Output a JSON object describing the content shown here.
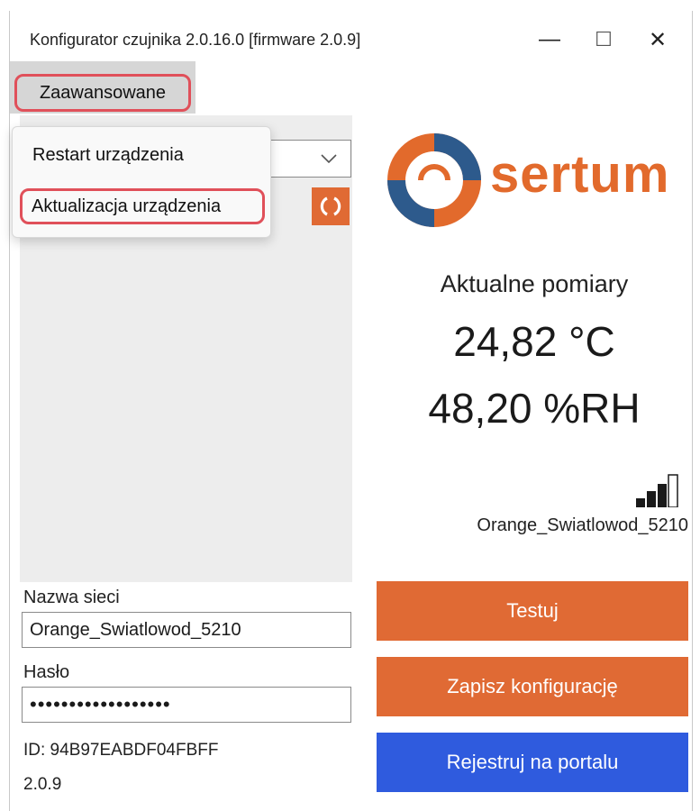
{
  "window": {
    "title": "Konfigurator czujnika 2.0.16.0 [firmware 2.0.9]",
    "stray_mark": "ʻ",
    "minimize": "—",
    "maximize": "☐",
    "close": "✕"
  },
  "menu": {
    "advanced_label": "Zaawansowane",
    "items": [
      "Restart urządzenia",
      "Aktualizacja urządzenia"
    ]
  },
  "logo": {
    "text": "sertum",
    "ring_color": "#e26a2c",
    "inner_color": "#2d5a8c"
  },
  "measurements": {
    "title": "Aktualne pomiary",
    "temperature": "24,82 °C",
    "humidity": "48,20 %RH"
  },
  "wifi": {
    "ssid": "Orange_Swiatlowod_5210",
    "signal_bars": 4,
    "signal_bars_filled": 3
  },
  "form": {
    "network_label": "Nazwa sieci",
    "network_value": "Orange_Swiatlowod_5210",
    "password_label": "Hasło",
    "password_value": "••••••••••••••••••",
    "id_text": "ID:  94B97EABDF04FBFF",
    "version": "2.0.9"
  },
  "buttons": {
    "test": "Testuj",
    "save": "Zapisz konfigurację",
    "register": "Rejestruj na portalu"
  },
  "colors": {
    "accent_orange": "#e06a34",
    "accent_blue": "#2f5bde",
    "highlight_red": "#e0505a"
  }
}
